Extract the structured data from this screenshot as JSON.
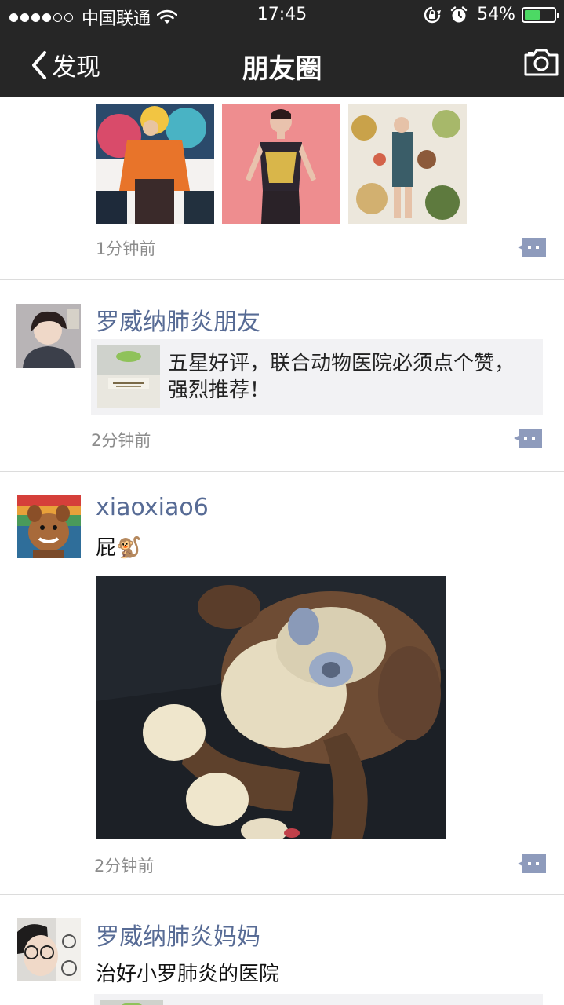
{
  "status_bar": {
    "carrier": "中国联通",
    "time": "17:45",
    "battery_percent": "54%",
    "battery_level": 0.54,
    "signal_bars_filled": 3,
    "signal_bars_total": 5,
    "icons": [
      "wifi-icon",
      "rotation-lock-icon",
      "alarm-icon",
      "battery-icon"
    ]
  },
  "nav": {
    "back_label": "发现",
    "title": "朋友圈",
    "icons": [
      "chevron-left-icon",
      "camera-icon"
    ]
  },
  "colors": {
    "nav_background": "#262626",
    "name_link": "#576b95",
    "time_gray": "#8c8c8c",
    "comment_button": "#8e9bbc",
    "battery_green": "#4cd964",
    "link_card_bg": "#f2f2f4"
  },
  "posts": [
    {
      "time": "1分钟前",
      "photos": [
        "fashion-collage-photo",
        "fashion-model-photo",
        "floral-fashion-photo"
      ]
    },
    {
      "name": "罗威纳肺炎朋友",
      "link": {
        "title": "五星好评，联合动物医院必须点个赞，强烈推荐！"
      },
      "time": "2分钟前"
    },
    {
      "name": "xiaoxiao6",
      "text": "屁🐒",
      "photo": "plush-monkey-photo",
      "time": "2分钟前"
    },
    {
      "name": "罗威纳肺炎妈妈",
      "text": "治好小罗肺炎的医院"
    }
  ]
}
